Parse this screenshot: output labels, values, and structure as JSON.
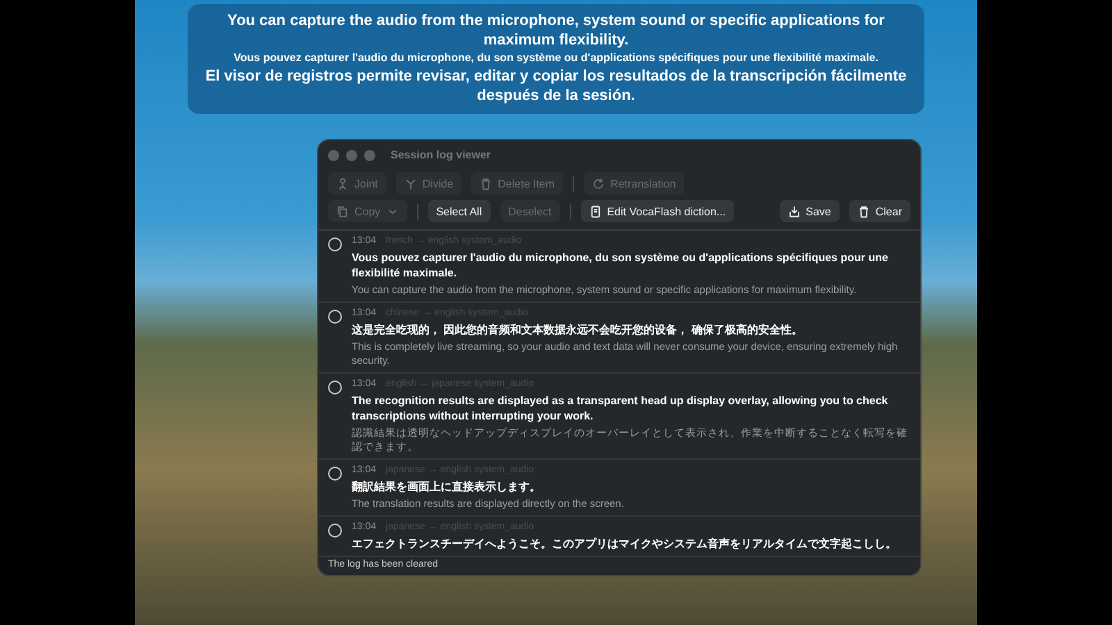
{
  "banner": {
    "lines": [
      {
        "kind": "primary",
        "text": "You can capture the audio from the microphone, system sound or specific applications for maximum flexibility."
      },
      {
        "kind": "secondary",
        "text": "Vous pouvez capturer l'audio du microphone, du son système ou d'applications spécifiques pour une flexibilité maximale."
      },
      {
        "kind": "primary",
        "text": "El visor de registros permite revisar, editar y copiar los resultados de la transcripción fácilmente después de la sesión."
      }
    ]
  },
  "window": {
    "title": "Session log viewer",
    "toolbar_rows": [
      [
        {
          "label": "Joint",
          "disabled": true
        },
        {
          "label": "Divide",
          "disabled": true
        },
        {
          "label": "Delete Item",
          "disabled": true
        },
        {
          "kind": "separator"
        },
        {
          "label": "Retranslation",
          "disabled": true
        }
      ],
      [
        {
          "label": "Copy",
          "disabled": true,
          "dropdown": true
        },
        {
          "kind": "separator"
        },
        {
          "label": "Select All",
          "disabled": false
        },
        {
          "label": "Deselect",
          "disabled": true
        },
        {
          "kind": "separator"
        },
        {
          "label": "Edit VocaFlash diction...",
          "disabled": false
        },
        {
          "kind": "spacer"
        },
        {
          "label": "Save",
          "disabled": false
        },
        {
          "label": "Clear",
          "disabled": false
        }
      ]
    ],
    "entries": [
      {
        "selected": false,
        "time": "13:04",
        "meta": "french → english  system_audio",
        "original": "Vous pouvez capturer l'audio du microphone, du son système ou d'applications spécifiques pour une flexibilité maximale.",
        "translation": "You can capture the audio from the microphone, system sound or specific applications for maximum flexibility."
      },
      {
        "selected": false,
        "time": "13:04",
        "meta": "chinese → english  system_audio",
        "original": "这是完全吃现的， 因此您的音频和文本数据永远不会吃开您的设备， 确保了极高的安全性。",
        "translation": "This is completely live streaming, so your audio and text data will never consume your device, ensuring extremely high security."
      },
      {
        "selected": false,
        "time": "13:04",
        "meta": "english → japanese  system_audio",
        "original": "The recognition results are displayed as a transparent head up display overlay, allowing you to check transcriptions without interrupting your work.",
        "translation": "認識結果は透明なヘッドアップディスプレイのオーバーレイとして表示され、作業を中断することなく転写を確認できます。"
      },
      {
        "selected": false,
        "time": "13:04",
        "meta": "japanese → english  system_audio",
        "original": "翻訳結果を画面上に直接表示します。",
        "translation": "The translation results are displayed directly on the screen."
      },
      {
        "selected": false,
        "time": "13:04",
        "meta": "japanese → english  system_audio",
        "original": "エフェクトランスチーデイへようこそ。このアプリはマイクやシステム音声をリアルタイムで文字起こしし。"
      }
    ],
    "status": "The log has been cleared"
  }
}
